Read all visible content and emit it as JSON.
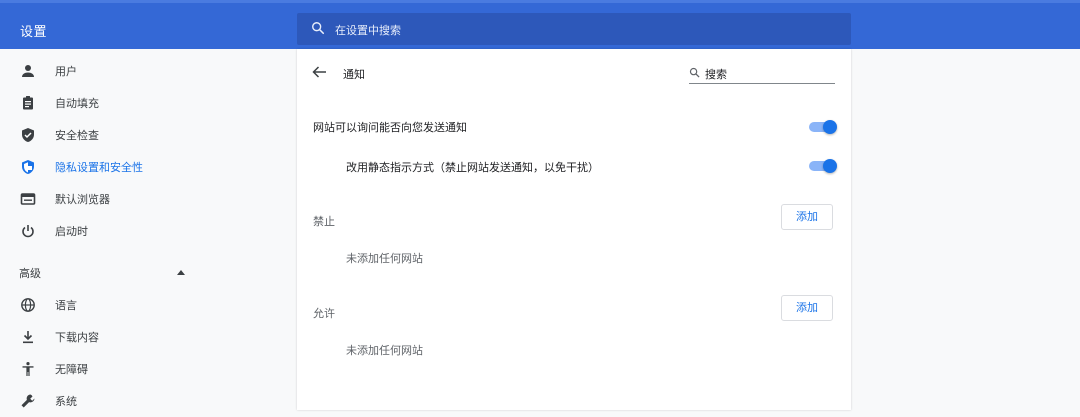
{
  "app": {
    "title": "设置"
  },
  "search": {
    "placeholder": "在设置中搜索"
  },
  "sidebar": {
    "items": [
      {
        "label": "用户",
        "icon": "person-icon",
        "active": false
      },
      {
        "label": "自动填充",
        "icon": "clipboard-icon",
        "active": false
      },
      {
        "label": "安全检查",
        "icon": "shield-check-icon",
        "active": false
      },
      {
        "label": "隐私设置和安全性",
        "icon": "privacy-shield-icon",
        "active": true
      },
      {
        "label": "默认浏览器",
        "icon": "browser-icon",
        "active": false
      },
      {
        "label": "启动时",
        "icon": "power-icon",
        "active": false
      }
    ],
    "advanced_label": "高级",
    "advanced_items": [
      {
        "label": "语言",
        "icon": "globe-icon"
      },
      {
        "label": "下载内容",
        "icon": "download-icon"
      },
      {
        "label": "无障碍",
        "icon": "accessibility-icon"
      },
      {
        "label": "系统",
        "icon": "wrench-icon"
      }
    ]
  },
  "page": {
    "title": "通知",
    "search_label": "搜索",
    "ask_setting": {
      "label": "网站可以询问能否向您发送通知",
      "enabled": true
    },
    "quiet_setting": {
      "label": "改用静态指示方式（禁止网站发送通知，以免干扰）",
      "enabled": true
    },
    "block": {
      "heading": "禁止",
      "add_label": "添加",
      "empty_text": "未添加任何网站"
    },
    "allow": {
      "heading": "允许",
      "add_label": "添加",
      "empty_text": "未添加任何网站"
    }
  },
  "colors": {
    "header_bg": "#3468d6",
    "search_bg": "#2d58ba",
    "accent": "#1a73e8",
    "toggle_track": "#8ab4f8"
  }
}
